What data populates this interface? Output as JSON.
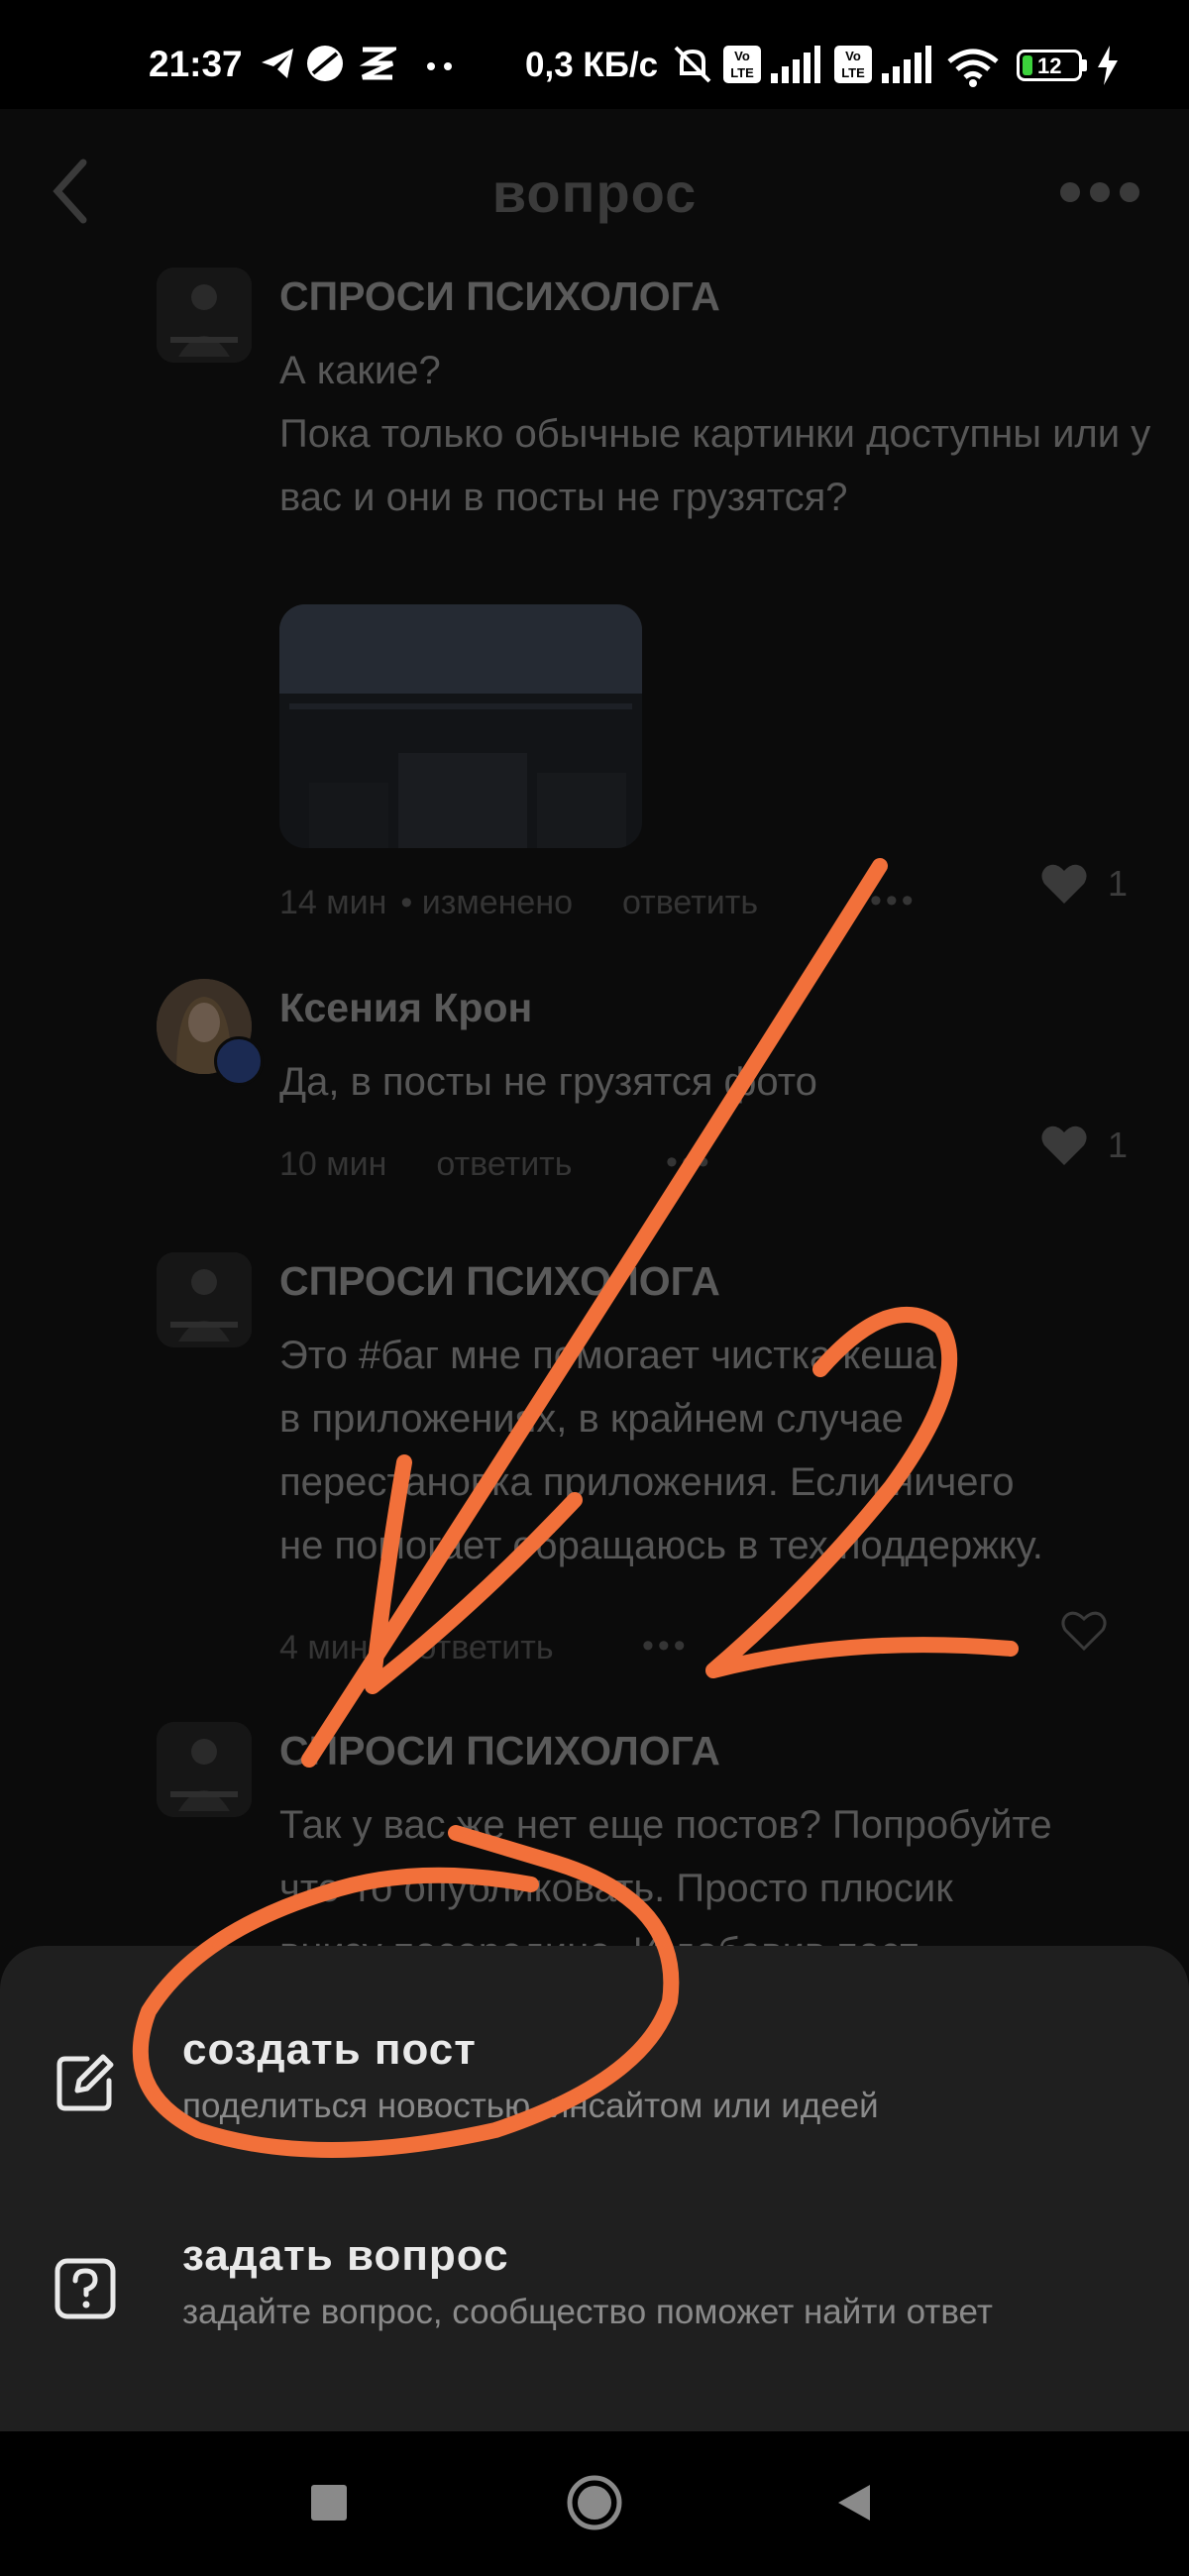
{
  "status_bar": {
    "time": "21:37",
    "network_speed": "0,3 КБ/с",
    "volte_label": "Vo LTE",
    "battery": "12",
    "icons": [
      "telegram-icon",
      "app-icon",
      "app-icon",
      "more-icon",
      "mute-icon",
      "volte-icon",
      "signal-icon",
      "volte-icon",
      "signal-icon",
      "wifi-icon",
      "battery-icon",
      "charging-icon"
    ]
  },
  "header": {
    "title": "вопрос",
    "back_icon": "chevron-left-icon",
    "menu_icon": "more-icon"
  },
  "comments": [
    {
      "author": "СПРОСИ ПСИХОЛОГА",
      "text": "А какие?\nПока только обычные картинки доступны или у вас и они в посты не грузятся?",
      "time": "14 мин",
      "edited": "• изменено",
      "reply": "ответить",
      "likes": "1",
      "has_photo": true
    },
    {
      "author": "Ксения Крон",
      "text": "Да, в посты не грузятся фото",
      "time": "10 мин",
      "reply": "ответить",
      "likes": "1"
    },
    {
      "author": "СПРОСИ ПСИХОЛОГА",
      "text": "Это #баг мне помогает чистка кеша\nв приложениях, в крайнем случае\nперестановка приложения. Если ничего\nне помогает обращаюсь в тех.поддержку.",
      "time": "4 мин",
      "reply": "ответить",
      "likes": ""
    },
    {
      "author": "СПРОСИ ПСИХОЛОГА",
      "text": "Так у вас же нет еще постов? Попробуйте\nчто-то опубликовать. Просто плюсик\nвнизу посередине. И добавив пост"
    }
  ],
  "sheet": {
    "options": [
      {
        "title": "создать пост",
        "subtitle": "поделиться новостью, инсайтом или идеей",
        "icon": "edit-icon"
      },
      {
        "title": "задать вопрос",
        "subtitle": "задайте вопрос, сообщество поможет найти ответ",
        "icon": "question-icon"
      }
    ]
  },
  "nav_bar": {
    "icons": [
      "recents-square-icon",
      "home-circle-icon",
      "back-triangle-icon"
    ]
  },
  "annotation": {
    "label": "2",
    "color": "#f2703a"
  },
  "colors": {
    "accent": "#f2703a",
    "sheet_bg": "#1f1f1f",
    "app_bg": "#0b0b0b"
  }
}
